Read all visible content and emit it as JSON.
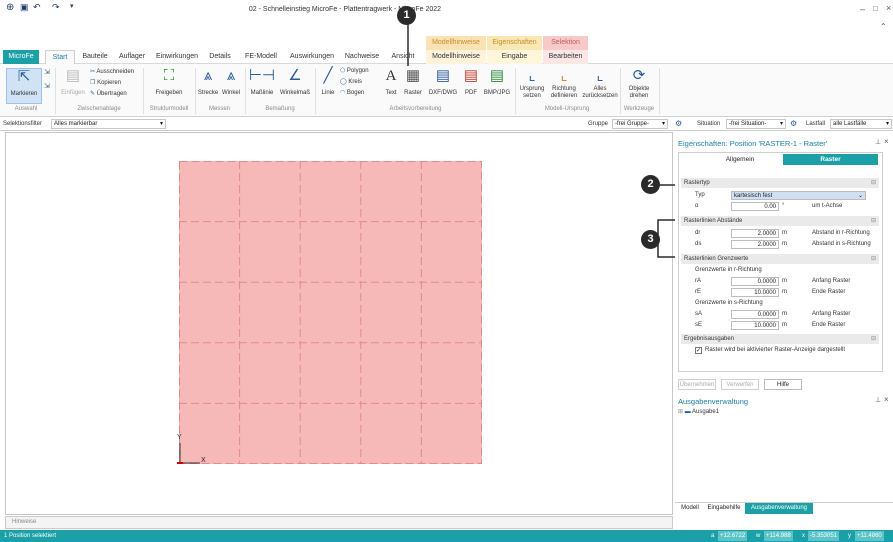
{
  "window": {
    "title": "02 - Schnelleinstieg MicroFe - Plattentragwerk - MicroFe 2022"
  },
  "context_groups": [
    {
      "label": "Modellhinweise",
      "color": "#fbe2b4",
      "tab": "Modellhinweise"
    },
    {
      "label": "Eigenschaften",
      "color": "#f9e7b4",
      "tab": "Eingabe"
    },
    {
      "label": "Selektion",
      "color": "#f7c9c9",
      "tab": "Bearbeiten"
    }
  ],
  "menu": {
    "app": "MicroFe",
    "tabs": [
      "Start",
      "Bauteile",
      "Auflager",
      "Einwirkungen",
      "Details",
      "FE-Modell",
      "Auswirkungen",
      "Nachweise",
      "Ansicht"
    ]
  },
  "ribbon": {
    "groups": [
      {
        "label": "Auswahl",
        "buttons": [
          "Markieren"
        ]
      },
      {
        "label": "Zwischenablage",
        "buttons": [
          "Einfügen",
          "Ausschneiden",
          "Kopieren",
          "Übertragen"
        ]
      },
      {
        "label": "Strukturmodell",
        "buttons": [
          "Freigeben"
        ]
      },
      {
        "label": "Messen",
        "buttons": [
          "Strecke",
          "Winkel"
        ]
      },
      {
        "label": "Bemaßung",
        "buttons": [
          "Maßlinie",
          "Winkelmaß"
        ]
      },
      {
        "label": "Arbeitsvorbereitung",
        "buttons": [
          "Linie",
          "Polygon",
          "Kreis",
          "Bogen",
          "Text",
          "Raster",
          "DXF/DWG",
          "PDF",
          "BMP/JPG"
        ]
      },
      {
        "label": "Modell-Ursprung",
        "buttons": [
          "Ursprung setzen",
          "Richtung definieren",
          "Alles zurücksetzen"
        ]
      },
      {
        "label": "Werkzeuge",
        "buttons": [
          "Objekte drehen"
        ]
      }
    ]
  },
  "filterbar": {
    "selektionsfilter_label": "Selektionsfilter",
    "selektionsfilter_value": "Alles markierbar",
    "gruppe_label": "Gruppe",
    "gruppe_value": "-frei Gruppe-",
    "situation_label": "Situation",
    "situation_value": "-frei Situation-",
    "lastfall_label": "Lastfall",
    "lastfall_value": "alle Lastfälle"
  },
  "canvas": {
    "axis_y": "Y",
    "axis_x": "X"
  },
  "properties": {
    "title": "Eigenschaften: Position 'RASTER-1 - Raster'",
    "tabs": [
      "Allgemein",
      "Raster"
    ],
    "sections": {
      "rastertyp": "Rastertyp",
      "abstaende": "Rasterlinien Abstände",
      "grenzwerte": "Rasterlinien Grenzwerte",
      "ergebnis": "Ergebnisausgaben"
    },
    "rows": {
      "typ_label": "Typ",
      "typ_value": "kartesisch fest",
      "alpha_label": "α",
      "alpha_value": "0.00",
      "alpha_unit": "°",
      "alpha_desc": "um t-Achse",
      "dr_label": "dr",
      "dr_value": "2.0000",
      "dr_unit": "m",
      "dr_desc": "Abstand in r-Richtung",
      "ds_label": "ds",
      "ds_value": "2.0000",
      "ds_unit": "m",
      "ds_desc": "Abstand in s-Richtung",
      "gr_r_title": "Grenzwerte in r-Richtung",
      "ra_label": "rA",
      "ra_value": "0.0000",
      "ra_unit": "m",
      "ra_desc": "Anfang Raster",
      "re_label": "rE",
      "re_value": "10.0000",
      "re_unit": "m",
      "re_desc": "Ende Raster",
      "gr_s_title": "Grenzwerte in s-Richtung",
      "sa_label": "sA",
      "sa_value": "0.0000",
      "sa_unit": "m",
      "sa_desc": "Anfang Raster",
      "se_label": "sE",
      "se_value": "10.0000",
      "se_unit": "m",
      "se_desc": "Ende Raster",
      "checkbox_label": "Raster wird bei aktivierter Raster-Anzeige dargestellt"
    },
    "buttons": [
      "Übernehmen",
      "Verwerfen",
      "Hilfe"
    ]
  },
  "output": {
    "title": "Ausgabenverwaltung",
    "item": "Ausgabe1"
  },
  "bottom_tabs": [
    "Modell",
    "Eingabehilfe",
    "Ausgabenverwaltung"
  ],
  "hinweise": "Hinweise",
  "status": {
    "text": "1 Position selektiert",
    "coords": [
      {
        "k": "a",
        "v": "+12.6722"
      },
      {
        "k": "w",
        "v": "+114.988"
      },
      {
        "k": "x",
        "v": "-5.353051"
      },
      {
        "k": "y",
        "v": "+11.4860"
      }
    ]
  },
  "callouts": [
    "1",
    "2",
    "3"
  ],
  "colors": {
    "accent": "#1aa0a6",
    "raster_fill": "#f7b8b8"
  }
}
